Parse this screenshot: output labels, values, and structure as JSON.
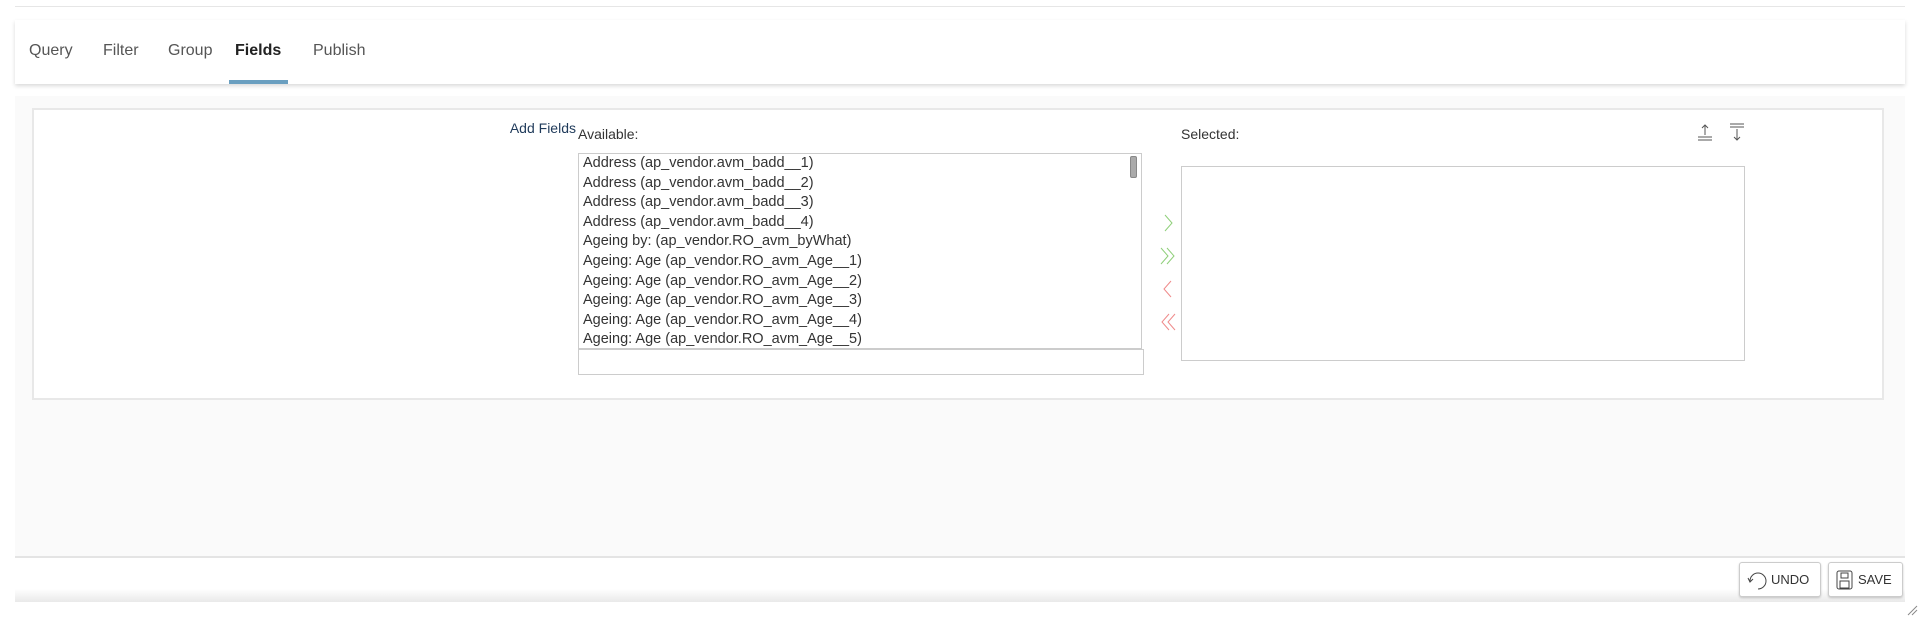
{
  "tabs": [
    {
      "label": "Query"
    },
    {
      "label": "Filter"
    },
    {
      "label": "Group"
    },
    {
      "label": "Fields",
      "active": true
    },
    {
      "label": "Publish"
    }
  ],
  "colors": {
    "tab_active_underline": "#6a9fc0",
    "add_arrow": "#8fcf7a",
    "remove_arrow": "#ef8a8a"
  },
  "fields": {
    "section_label": "Add Fields",
    "available_label": "Available:",
    "selected_label": "Selected:",
    "available_items": [
      "Address (ap_vendor.avm_badd__1)",
      "Address (ap_vendor.avm_badd__2)",
      "Address (ap_vendor.avm_badd__3)",
      "Address (ap_vendor.avm_badd__4)",
      "Ageing by: (ap_vendor.RO_avm_byWhat)",
      "Ageing: Age (ap_vendor.RO_avm_Age__1)",
      "Ageing: Age (ap_vendor.RO_avm_Age__2)",
      "Ageing: Age (ap_vendor.RO_avm_Age__3)",
      "Ageing: Age (ap_vendor.RO_avm_Age__4)",
      "Ageing: Age (ap_vendor.RO_avm_Age__5)"
    ],
    "filter_value": "",
    "selected_items": []
  },
  "footer": {
    "undo_label": "UNDO",
    "save_label": "SAVE"
  }
}
